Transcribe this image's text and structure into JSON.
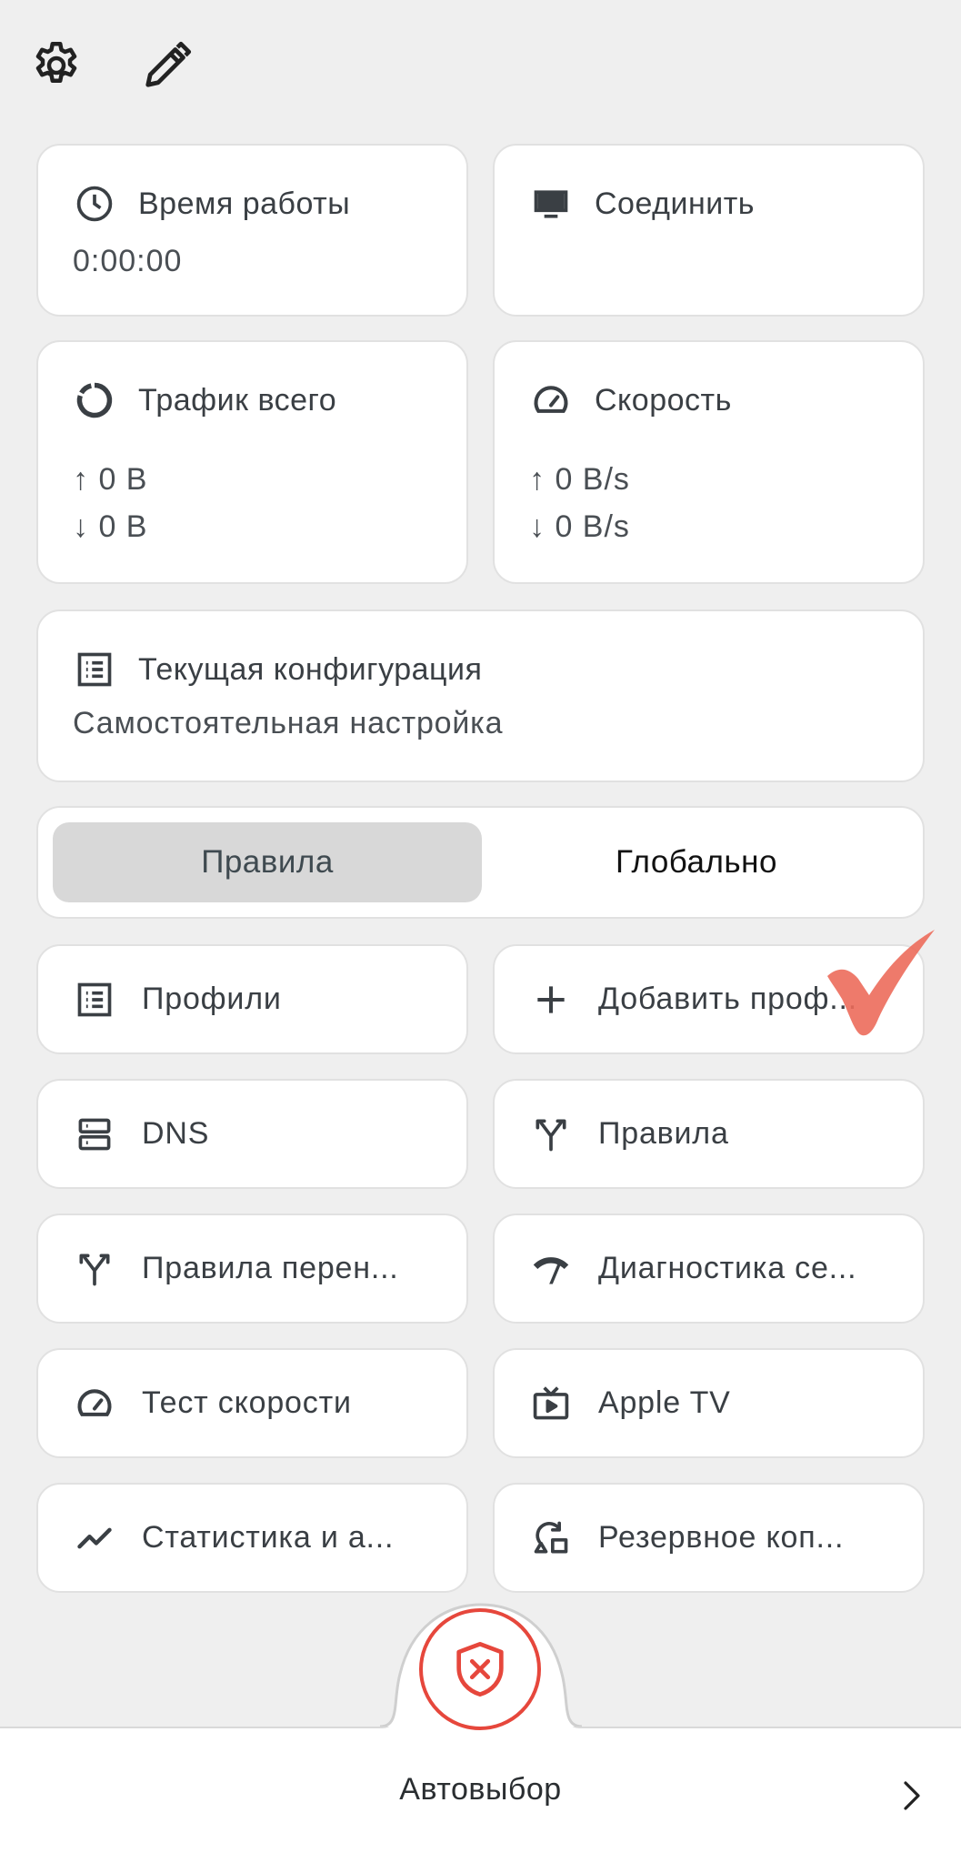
{
  "toolbar": {
    "settings_icon": "gear-icon",
    "edit_icon": "pencil-icon"
  },
  "stats": {
    "uptime": {
      "title": "Время работы",
      "value": "0:00:00",
      "icon": "clock-icon"
    },
    "connect": {
      "title": "Соединить",
      "icon": "monitor-icon"
    },
    "traffic": {
      "title": "Трафик всего",
      "up": "↑ 0 B",
      "down": "↓ 0 B",
      "icon": "donut-icon"
    },
    "speed": {
      "title": "Скорость",
      "up": "↑ 0 B/s",
      "down": "↓ 0 B/s",
      "icon": "speedometer-icon"
    },
    "config": {
      "title": "Текущая конфигурация",
      "value": "Самостоятельная настройка",
      "icon": "list-icon"
    }
  },
  "mode": {
    "rules": "Правила",
    "global": "Глобально",
    "selected": "rules"
  },
  "tiles": [
    {
      "label": "Профили",
      "icon": "list-icon"
    },
    {
      "label": "Добавить проф...",
      "icon": "plus-icon"
    },
    {
      "label": "DNS",
      "icon": "server-icon"
    },
    {
      "label": "Правила",
      "icon": "split-arrow-icon"
    },
    {
      "label": "Правила перен...",
      "icon": "split-arrow-icon"
    },
    {
      "label": "Диагностика се...",
      "icon": "network-diagnostics-icon"
    },
    {
      "label": "Тест скорости",
      "icon": "speedometer-icon"
    },
    {
      "label": "Apple TV",
      "icon": "tv-icon"
    },
    {
      "label": "Статистика и а...",
      "icon": "trend-line-icon"
    },
    {
      "label": "Резервное коп...",
      "icon": "backup-restore-icon"
    }
  ],
  "bottom": {
    "proxy_label": "Автовыбор",
    "vpn_icon": "shield-x-icon",
    "chevron_icon": "chevron-right-icon"
  },
  "colors": {
    "background": "#efefef",
    "card": "#ffffff",
    "accent_red": "#e6473c",
    "active_segment": "#d8d8d8"
  }
}
